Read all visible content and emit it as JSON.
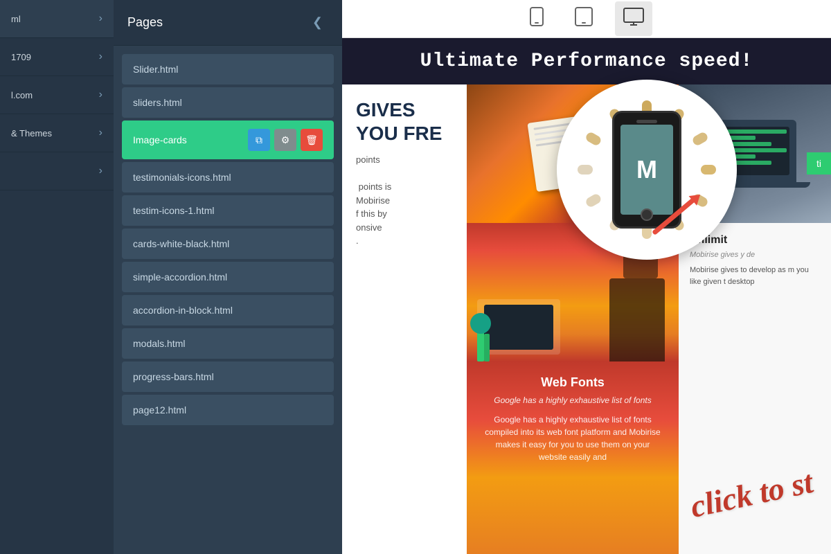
{
  "sidebar": {
    "items": [
      {
        "label": "ml",
        "id": "item-ml"
      },
      {
        "label": "1709",
        "id": "item-1709"
      },
      {
        "label": "l.com",
        "id": "item-lcom"
      },
      {
        "label": "& Themes",
        "id": "item-themes"
      },
      {
        "label": "",
        "id": "item-extra"
      }
    ]
  },
  "pages_panel": {
    "title": "Pages",
    "close_icon": "❮",
    "items": [
      {
        "name": "Slider.html",
        "active": false
      },
      {
        "name": "sliders.html",
        "active": false
      },
      {
        "name": "Image-cards",
        "active": true
      },
      {
        "name": "testimonials-icons.html",
        "active": false
      },
      {
        "name": "testim-icons-1.html",
        "active": false
      },
      {
        "name": "cards-white-black.html",
        "active": false
      },
      {
        "name": "simple-accordion.html",
        "active": false
      },
      {
        "name": "accordion-in-block.html",
        "active": false
      },
      {
        "name": "modals.html",
        "active": false
      },
      {
        "name": "progress-bars.html",
        "active": false
      },
      {
        "name": "page12.html",
        "active": false
      }
    ],
    "action_copy": "⧉",
    "action_settings": "⚙",
    "action_delete": "🗑"
  },
  "toolbar": {
    "mobile_label": "📱",
    "tablet_label": "⬜",
    "desktop_label": "🖥"
  },
  "preview": {
    "banner_text": "Ultimate Performance speed!",
    "heading": "GIVES YOU FRE",
    "subtext": "points\n\ns points is\nMobirise\nf this by\nonsive\n.",
    "card_title": "Web Fonts",
    "card_subtitle": "Google has a highly exhaustive list of fonts",
    "card_text": "Google has a highly exhaustive list of fonts compiled into its web font platform and Mobirise makes it easy for you to use them on your website easily and",
    "right_title": "Unlimit",
    "right_subtitle": "Mobirise gives y de",
    "right_text": "Mobirise gives to develop as m you like given t desktop",
    "cta_button": "ti",
    "click_annotation": "click to st"
  }
}
